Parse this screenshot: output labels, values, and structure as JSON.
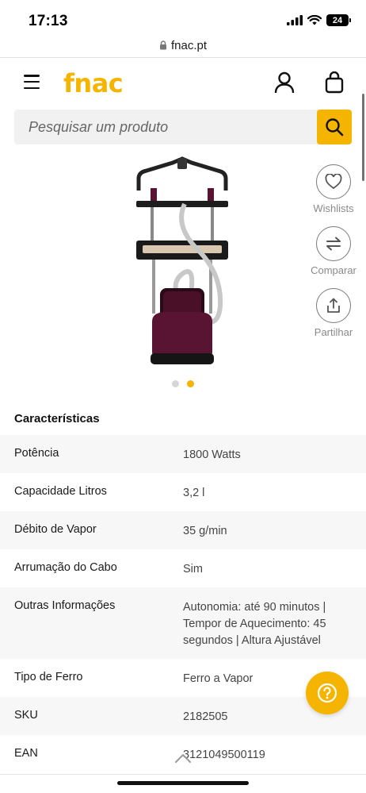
{
  "status_bar": {
    "time": "17:13",
    "battery": "24"
  },
  "browser": {
    "url": "fnac.pt"
  },
  "header": {
    "logo": "fnac"
  },
  "search": {
    "placeholder": "Pesquisar um produto"
  },
  "side_actions": [
    {
      "label": "Wishlists",
      "icon": "heart-icon"
    },
    {
      "label": "Comparar",
      "icon": "compare-arrows-icon"
    },
    {
      "label": "Partilhar",
      "icon": "share-icon"
    }
  ],
  "carousel": {
    "count": 2,
    "active": 2
  },
  "characteristics": {
    "title": "Características",
    "rows": [
      {
        "label": "Potência",
        "value": "1800 Watts"
      },
      {
        "label": "Capacidade Litros",
        "value": "3,2 l"
      },
      {
        "label": "Débito de Vapor",
        "value": "35 g/min"
      },
      {
        "label": "Arrumação do Cabo",
        "value": "Sim"
      },
      {
        "label": "Outras Informações",
        "value": "Autonomia: até 90 minutos | Tempor de Aquecimento: 45 segundos | Altura Ajustável"
      },
      {
        "label": "Tipo de Ferro",
        "value": "Ferro a Vapor"
      },
      {
        "label": "SKU",
        "value": "2182505"
      },
      {
        "label": "EAN",
        "value": "3121049500119"
      }
    ]
  },
  "colors": {
    "accent": "#f5b400",
    "row_shade": "#f7f7f7",
    "product": "#5a1433"
  }
}
